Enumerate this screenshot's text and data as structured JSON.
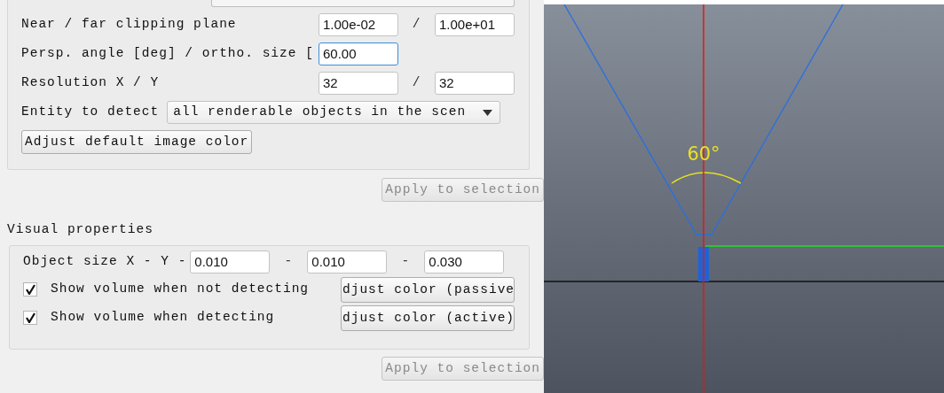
{
  "sensor_settings": {
    "rows": [
      {
        "kind": "pair",
        "label": "Near / far clipping plane",
        "values": [
          "1.00e-02",
          "1.00e+01"
        ],
        "separator": "/"
      },
      {
        "kind": "single",
        "label": "Persp. angle [deg] / ortho. size [",
        "value": "60.00",
        "focused": true
      },
      {
        "kind": "pair",
        "label": "Resolution X / Y",
        "values": [
          "32",
          "32"
        ],
        "separator": "/"
      },
      {
        "kind": "select",
        "label": "Entity to detect",
        "value": "all renderable objects in the scen"
      },
      {
        "kind": "button",
        "label": "Adjust default image color"
      }
    ],
    "apply_button": {
      "label": "Apply to selection",
      "disabled": true
    }
  },
  "visual_properties": {
    "title": "Visual properties",
    "object_size": {
      "label": "Object size X - Y -",
      "values": [
        "0.010",
        "0.010",
        "0.030"
      ],
      "separators": [
        "-",
        "-"
      ]
    },
    "options": [
      {
        "label": "Show volume when not detecting",
        "checked": true,
        "button": "djust color (passive"
      },
      {
        "label": "Show volume when detecting",
        "checked": true,
        "button": "djust color (active)"
      }
    ],
    "apply_button": {
      "label": "Apply to selection",
      "disabled": true
    }
  },
  "viewport": {
    "angle_label": "60°"
  }
}
